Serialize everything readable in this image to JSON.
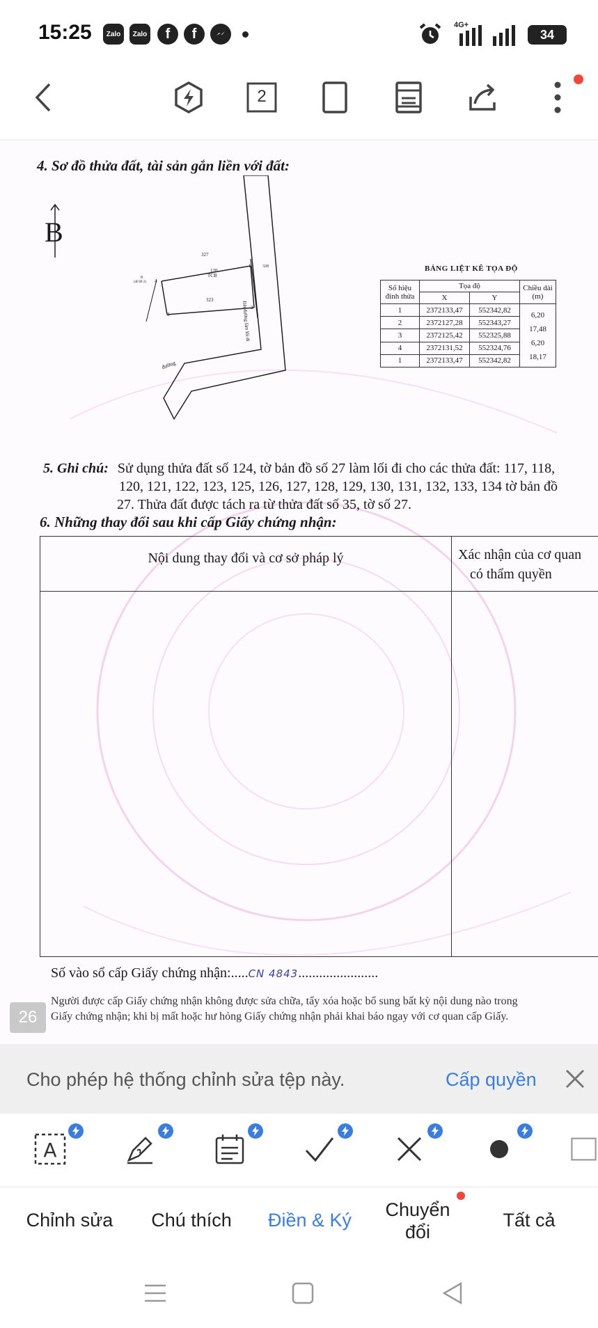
{
  "status_bar": {
    "time": "15:25",
    "notifications": [
      "Zalo",
      "Zalo"
    ],
    "network_label": "4G+",
    "battery": "34"
  },
  "toolbar": {
    "page_count": "2"
  },
  "document": {
    "section4_title": "4. Sơ đồ thửa đất, tài sản gắn liền với đất:",
    "north_label": "B",
    "map_labels": {
      "parcel_top": "327",
      "parcel_mid": "120",
      "parcel_mid2": "TCB",
      "parcel_bottom": "323",
      "left_ref": "8",
      "left_ref2": "(40 M 2)",
      "road": "đường",
      "vertical_road": "Đất đường làm lối đi",
      "side_number": "328",
      "points": [
        "1",
        "2",
        "3",
        "4"
      ]
    },
    "coord_table": {
      "title": "BẢNG LIỆT KÊ TỌA ĐỘ",
      "col_point": "Số hiệu đỉnh thửa",
      "col_coords": "Tọa độ",
      "col_x": "X",
      "col_y": "Y",
      "col_length": "Chiều dài (m)",
      "rows": [
        {
          "point": "1",
          "x": "2372133,47",
          "y": "552342,82"
        },
        {
          "point": "2",
          "x": "2372127,28",
          "y": "552343,27"
        },
        {
          "point": "3",
          "x": "2372125,42",
          "y": "552325,88"
        },
        {
          "point": "4",
          "x": "2372131,52",
          "y": "552324,76"
        },
        {
          "point": "1",
          "x": "2372133,47",
          "y": "552342,82"
        }
      ],
      "lengths": [
        "6,20",
        "17,48",
        "6,20",
        "18,17"
      ]
    },
    "note_label": "5. Ghi chú:",
    "note_line1": "Sử dụng thửa đất số 124, tờ bản đồ số 27 làm lối đi cho các thửa đất: 117, 118,",
    "note_line2": "120, 121, 122, 123, 125, 126, 127, 128, 129, 130, 131, 132, 133, 134 tờ bản đồ",
    "note_line3": "27. Thửa đất được tách ra từ thửa đất số 35, tờ số 27.",
    "section6_title": "6. Những thay đổi sau khi cấp Giấy chứng nhận:",
    "changes_col1": "Nội dung thay đổi và cơ sở pháp lý",
    "changes_col2_line1": "Xác nhận của cơ quan",
    "changes_col2_line2": "có thẩm quyền",
    "registry_label": "Số vào sổ cấp Giấy chứng nhận:.....",
    "registry_code": "CN 4843",
    "registry_dots": ".......................",
    "fine_line1": "Người được cấp Giấy chứng nhận không được sửa chữa, tẩy xóa hoặc bổ sung bất kỳ nội dung nào trong",
    "fine_line2": "Giấy chứng nhận; khi bị mất hoặc hư hỏng Giấy chứng nhận phải khai báo ngay với cơ quan cấp Giấy.",
    "page_number": "26"
  },
  "banner": {
    "text": "Cho phép hệ thống chỉnh sửa tệp này.",
    "action": "Cấp quyền"
  },
  "tabs": {
    "items": [
      "Chỉnh sửa",
      "Chú thích",
      "Điền & Ký",
      "Chuyển đổi",
      "Tất cả"
    ],
    "convert_line1": "Chuyển",
    "convert_line2": "đổi",
    "active": "Điền & Ký"
  },
  "colors": {
    "accent": "#3a7de0",
    "badge_red": "#f0473a",
    "banner_bg": "#efefef"
  }
}
